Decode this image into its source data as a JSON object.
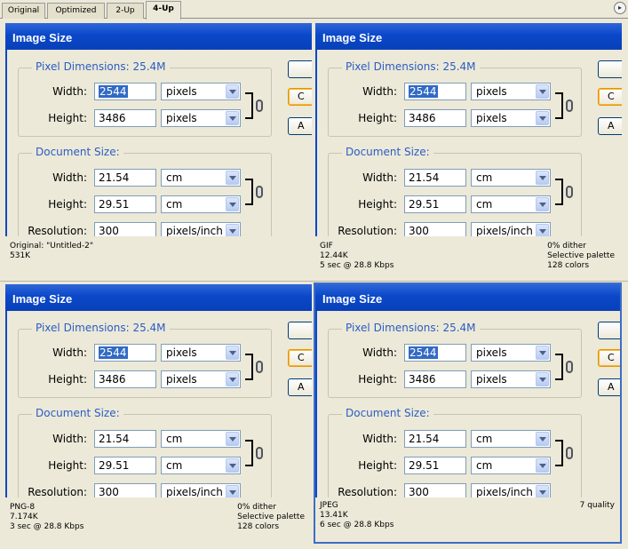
{
  "tabs": [
    "Original",
    "Optimized",
    "2-Up",
    "4-Up"
  ],
  "active_tab": "4-Up",
  "dialog": {
    "title": "Image Size",
    "pixel_dimensions_label": "Pixel Dimensions:  25.4M",
    "document_size_label": "Document Size:",
    "width_label": "Width:",
    "height_label": "Height:",
    "resolution_label": "Resolution:",
    "pixel_width": "2544",
    "pixel_height": "3486",
    "pixel_unit": "pixels",
    "doc_width": "21.54",
    "doc_height": "29.51",
    "doc_unit": "cm",
    "resolution": "300",
    "resolution_unit": "pixels/inch",
    "button_1": "",
    "button_2": "C",
    "button_3": "A"
  },
  "panels": [
    {
      "name": "original",
      "left": [
        "Original: \"Untitled-2\"",
        "531K",
        ""
      ],
      "right": [
        "",
        "",
        ""
      ]
    },
    {
      "name": "gif",
      "left": [
        "GIF",
        "12.44K",
        "5 sec @ 28.8 Kbps"
      ],
      "right": [
        "0% dither",
        "Selective palette",
        "128 colors"
      ]
    },
    {
      "name": "png8",
      "left": [
        "PNG-8",
        "7.174K",
        "3 sec @ 28.8 Kbps"
      ],
      "right": [
        "0% dither",
        "Selective palette",
        "128 colors"
      ]
    },
    {
      "name": "jpeg",
      "left": [
        "JPEG",
        "13.41K",
        "6 sec @ 28.8 Kbps"
      ],
      "right": [
        "7 quality",
        "",
        ""
      ]
    }
  ],
  "colors": {
    "title_blue": "#0a48c9",
    "legend_blue": "#2b5cc4",
    "selection": "#316ac5",
    "selected_panel_border": "#3c6ec8"
  }
}
